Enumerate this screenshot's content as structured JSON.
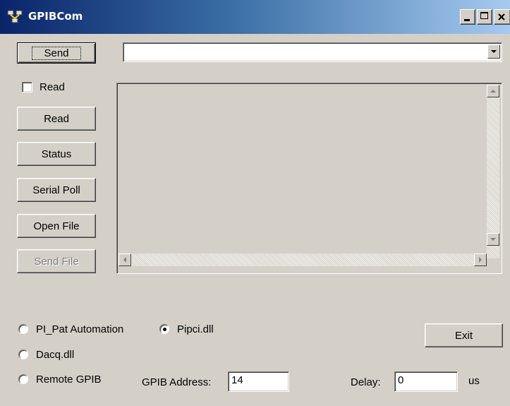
{
  "window": {
    "title": "GPIBCom",
    "icon": "network-app-icon"
  },
  "buttons": {
    "send": "Send",
    "read": "Read",
    "status": "Status",
    "serial_poll": "Serial Poll",
    "open_file": "Open File",
    "send_file": "Send File",
    "exit": "Exit"
  },
  "read_checkbox": {
    "label": "Read",
    "checked": false
  },
  "command_combo": {
    "value": ""
  },
  "radios": {
    "pi_pat": {
      "label": "PI_Pat Automation",
      "selected": false
    },
    "pipci": {
      "label": "Pipci.dll",
      "selected": true
    },
    "dacq": {
      "label": "Dacq.dll",
      "selected": false
    },
    "remote": {
      "label": "Remote GPIB",
      "selected": false
    }
  },
  "gpib_address": {
    "label": "GPIB Address:",
    "value": "14"
  },
  "delay": {
    "label": "Delay:",
    "value": "0",
    "unit": "us"
  }
}
